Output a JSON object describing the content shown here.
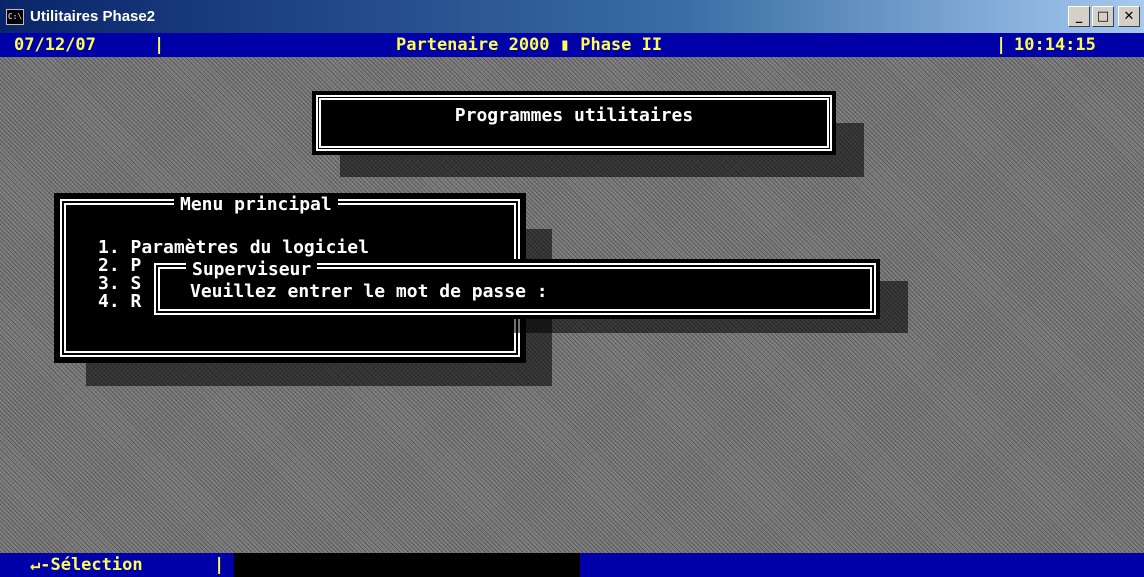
{
  "window": {
    "icon_text": "C:\\",
    "title": "Utilitaires Phase2",
    "minimize": "_",
    "maximize": "□",
    "close": "✕"
  },
  "header": {
    "date": "07/12/07",
    "separator_left": "|",
    "app_name": "Partenaire 2000 ▮ Phase II",
    "separator_right": "|",
    "time": "10:14:15"
  },
  "banner": {
    "title": "Programmes utilitaires"
  },
  "menu": {
    "title": "Menu principal",
    "items": [
      "1. Paramètres du logiciel",
      "2. P",
      "3. S",
      "4. R"
    ]
  },
  "dialog": {
    "title": "Superviseur",
    "prompt": "Veuillez entrer le mot de passe :",
    "password_value": ""
  },
  "footer": {
    "selection_label": "↵-Sélection",
    "separator": "|"
  }
}
